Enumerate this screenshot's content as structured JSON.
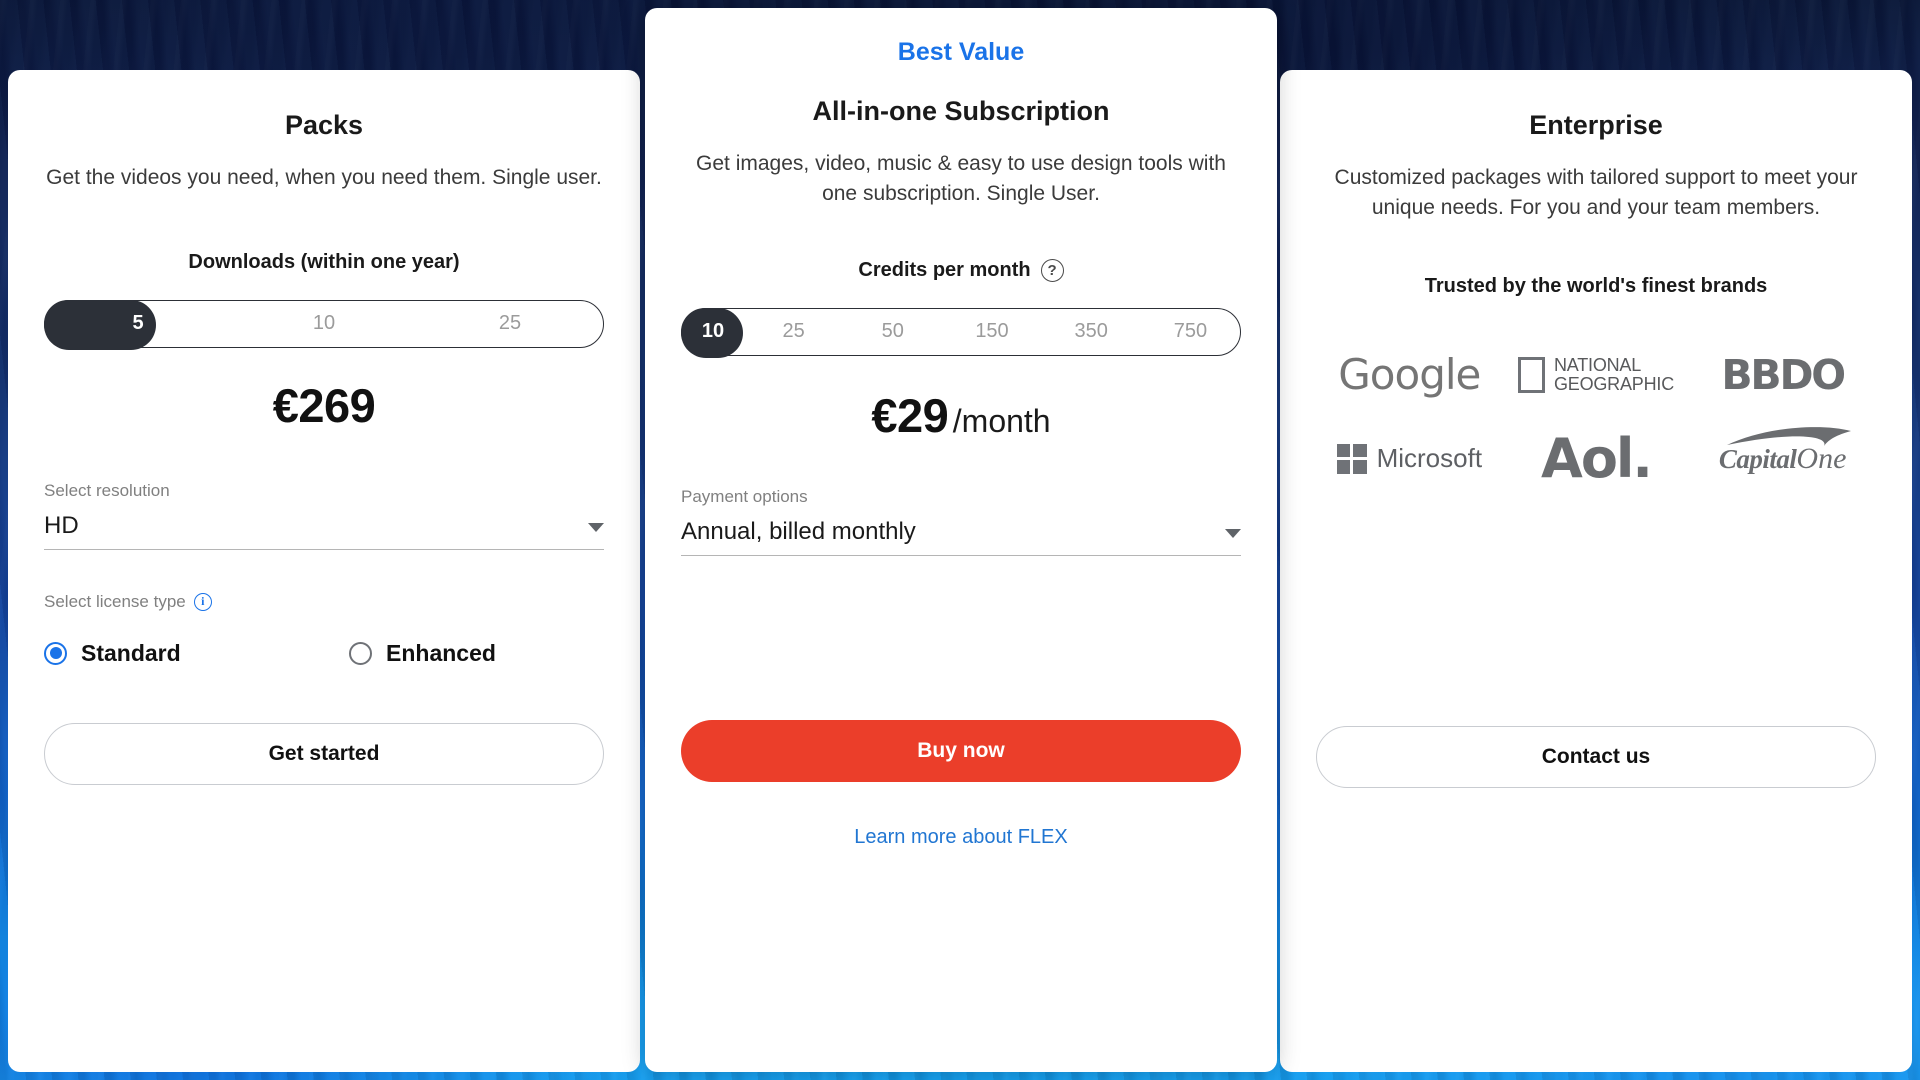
{
  "colors": {
    "accent_blue": "#1a73e8",
    "cta_red": "#eb3e2a",
    "pill_dark": "#2c3038",
    "link_blue": "#2176d2"
  },
  "packs_card": {
    "title": "Packs",
    "description": "Get the videos you need, when you need them. Single user.",
    "selector_label": "Downloads (within one year)",
    "options": [
      "5",
      "10",
      "25"
    ],
    "selected_option": "5",
    "price": "€269",
    "resolution_label": "Select resolution",
    "resolution_value": "HD",
    "license_label": "Select license type",
    "license_options": [
      {
        "label": "Standard",
        "selected": true
      },
      {
        "label": "Enhanced",
        "selected": false
      }
    ],
    "cta_label": "Get started",
    "info_icon": "info-circle-icon"
  },
  "subscription_card": {
    "badge": "Best Value",
    "title": "All-in-one Subscription",
    "description": "Get images, video, music & easy to use design tools with one subscription. Single User.",
    "selector_label": "Credits per month",
    "help_icon": "help-circle-icon",
    "options": [
      "10",
      "25",
      "50",
      "150",
      "350",
      "750"
    ],
    "selected_option": "10",
    "price": "€29",
    "price_suffix": "/month",
    "payment_label": "Payment options",
    "payment_value": "Annual, billed monthly",
    "cta_label": "Buy now",
    "link_label": "Learn more about FLEX"
  },
  "enterprise_card": {
    "title": "Enterprise",
    "description": "Customized packages with tailored support to meet your unique needs. For you and your team members.",
    "trusted_label": "Trusted by the world's finest brands",
    "brands": [
      {
        "name": "Google",
        "icon": "google-logo"
      },
      {
        "name": "NATIONAL GEOGRAPHIC",
        "icon": "national-geographic-logo",
        "line1": "NATIONAL",
        "line2": "GEOGRAPHIC"
      },
      {
        "name": "BBDO",
        "icon": "bbdo-logo"
      },
      {
        "name": "Microsoft",
        "icon": "microsoft-logo"
      },
      {
        "name": "Aol.",
        "icon": "aol-logo"
      },
      {
        "name": "CapitalOne",
        "icon": "capital-one-logo",
        "part1": "Capital",
        "part2": "One"
      }
    ],
    "cta_label": "Contact us"
  }
}
